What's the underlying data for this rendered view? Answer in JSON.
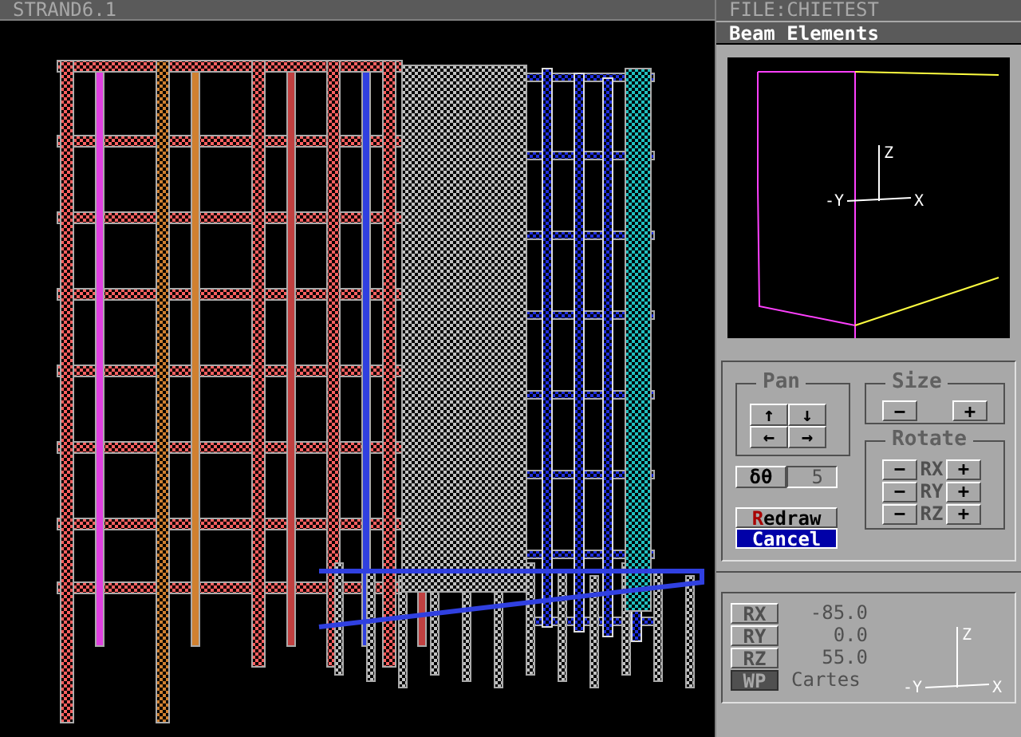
{
  "window": {
    "title": "STRAND6.1"
  },
  "file_bar": {
    "text": "FILE:CHIETEST"
  },
  "mode_bar": {
    "text": "Beam Elements"
  },
  "viewport": {
    "axis_labels": {
      "z": "Z",
      "y": "-Y",
      "x": "X"
    }
  },
  "pan": {
    "title": "Pan",
    "buttons": [
      "↑",
      "↓",
      "←",
      "→"
    ]
  },
  "size": {
    "title": "Size",
    "buttons": [
      "−",
      "+"
    ]
  },
  "step": {
    "label": "δθ",
    "value": "5"
  },
  "rotate": {
    "title": "Rotate",
    "rows": [
      {
        "minus": "−",
        "axis": "RX",
        "plus": "+"
      },
      {
        "minus": "−",
        "axis": "RY",
        "plus": "+"
      },
      {
        "minus": "−",
        "axis": "RZ",
        "plus": "+"
      }
    ]
  },
  "actions": [
    {
      "label": "Redraw",
      "selected": false
    },
    {
      "label": "Cancel",
      "selected": true
    }
  ],
  "info": {
    "rows": [
      {
        "label": "RX",
        "value": "-85.0",
        "selected": false
      },
      {
        "label": "RY",
        "value": "0.0",
        "selected": false
      },
      {
        "label": "RZ",
        "value": "55.0",
        "selected": false
      },
      {
        "label": "WP",
        "value": "Cartes",
        "selected": true
      }
    ],
    "axis_labels": {
      "z": "Z",
      "y": "-Y",
      "x": "X"
    }
  }
}
